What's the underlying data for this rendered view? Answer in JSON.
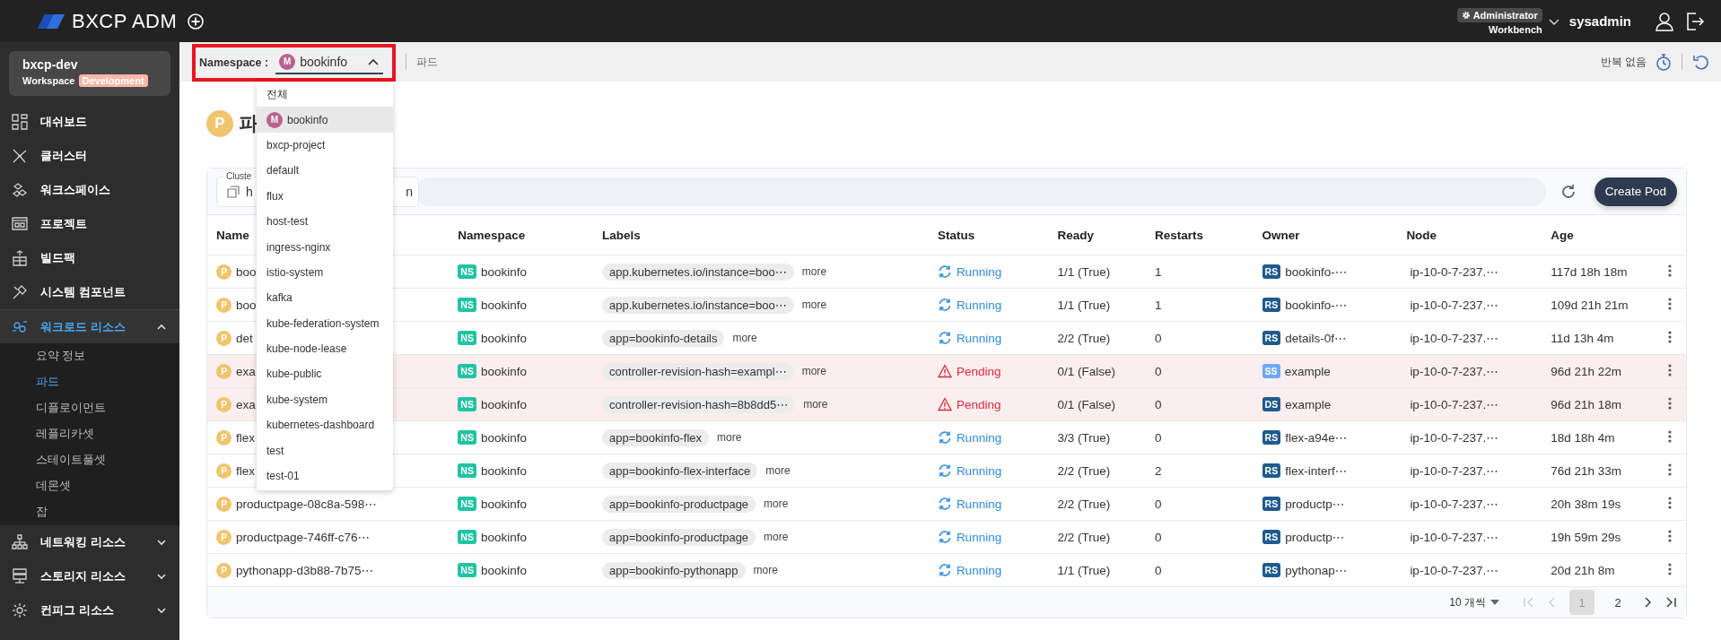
{
  "header": {
    "logo": "BXCP ADM",
    "role": "Administrator",
    "context": "Workbench",
    "user": "sysadmin"
  },
  "workspace": {
    "name": "bxcp-dev",
    "label": "Workspace",
    "env": "Development"
  },
  "sidebar": {
    "items": [
      {
        "label": "대쉬보드",
        "kind": "link",
        "selected": false
      },
      {
        "label": "클러스터",
        "kind": "link",
        "selected": false
      },
      {
        "label": "워크스페이스",
        "kind": "link",
        "selected": false
      },
      {
        "label": "프로젝트",
        "kind": "link",
        "selected": false
      },
      {
        "label": "빌드팩",
        "kind": "link",
        "selected": false
      },
      {
        "label": "시스템 컴포넌트",
        "kind": "link",
        "selected": false
      },
      {
        "label": "워크로드 리소스",
        "kind": "group",
        "selected": true,
        "expanded": true,
        "children": [
          {
            "label": "요약 정보",
            "selected": false
          },
          {
            "label": "파드",
            "selected": true
          },
          {
            "label": "디플로이먼트",
            "selected": false
          },
          {
            "label": "레플리카셋",
            "selected": false
          },
          {
            "label": "스테이트풀셋",
            "selected": false
          },
          {
            "label": "데몬셋",
            "selected": false
          },
          {
            "label": "잡",
            "selected": false
          }
        ]
      },
      {
        "label": "네트워킹 리소스",
        "kind": "group",
        "selected": false,
        "expanded": false
      },
      {
        "label": "스토리지 리소스",
        "kind": "group",
        "selected": false,
        "expanded": false
      },
      {
        "label": "컨피그 리소스",
        "kind": "group",
        "selected": false,
        "expanded": false
      }
    ]
  },
  "breadcrumb": {
    "namespace_label": "Namespace :",
    "namespace": {
      "avatar": "M",
      "value": "bookinfo",
      "open": true
    },
    "current": "파드",
    "repeat": "반복 없음"
  },
  "namespace_menu": {
    "items": [
      {
        "label": "전체",
        "selected": false
      },
      {
        "label": "bookinfo",
        "avatar": "M",
        "selected": true
      },
      {
        "label": "bxcp-project",
        "selected": false
      },
      {
        "label": "default",
        "selected": false
      },
      {
        "label": "flux",
        "selected": false
      },
      {
        "label": "host-test",
        "selected": false
      },
      {
        "label": "ingress-nginx",
        "selected": false
      },
      {
        "label": "istio-system",
        "selected": false
      },
      {
        "label": "kafka",
        "selected": false
      },
      {
        "label": "kube-federation-system",
        "selected": false
      },
      {
        "label": "kube-node-lease",
        "selected": false
      },
      {
        "label": "kube-public",
        "selected": false
      },
      {
        "label": "kube-system",
        "selected": false
      },
      {
        "label": "kubernetes-dashboard",
        "selected": false
      },
      {
        "label": "test",
        "selected": false
      },
      {
        "label": "test-01",
        "selected": false
      }
    ]
  },
  "page": {
    "badge": "P",
    "title": "파"
  },
  "toolbar": {
    "cluster_label": "Cluste",
    "cluster_value_start": "h",
    "cluster_value_end": "n",
    "create_button": "Create Pod"
  },
  "table": {
    "columns": [
      "Name",
      "Namespace",
      "Labels",
      "Status",
      "Ready",
      "Restarts",
      "Owner",
      "Node",
      "Age"
    ],
    "rows": [
      {
        "badge": "P",
        "name": "boo",
        "ns_badge": "NS",
        "namespace": "bookinfo",
        "label": "app.kubernetes.io/instance=boo⋯",
        "more": "more",
        "status": {
          "kind": "running",
          "text": "Running"
        },
        "ready": "1/1 (True)",
        "restarts": "1",
        "owner": {
          "badge": "RS",
          "color": "#1f5a8c",
          "name": "bookinfo-⋯"
        },
        "node": "ip-10-0-7-237.⋯",
        "age": "117d 18h 18m"
      },
      {
        "badge": "P",
        "name": "boo",
        "ns_badge": "NS",
        "namespace": "bookinfo",
        "label": "app.kubernetes.io/instance=boo⋯",
        "more": "more",
        "status": {
          "kind": "running",
          "text": "Running"
        },
        "ready": "1/1 (True)",
        "restarts": "1",
        "owner": {
          "badge": "RS",
          "color": "#1f5a8c",
          "name": "bookinfo-⋯"
        },
        "node": "ip-10-0-7-237.⋯",
        "age": "109d 21h 21m"
      },
      {
        "badge": "P",
        "name": "det",
        "ns_badge": "NS",
        "namespace": "bookinfo",
        "label": "app=bookinfo-details",
        "more": "more",
        "status": {
          "kind": "running",
          "text": "Running"
        },
        "ready": "2/2 (True)",
        "restarts": "0",
        "owner": {
          "badge": "RS",
          "color": "#1f5a8c",
          "name": "details-0f⋯"
        },
        "node": "ip-10-0-7-237.⋯",
        "age": "11d 13h 4m"
      },
      {
        "badge": "P",
        "name": "exa",
        "ns_badge": "NS",
        "namespace": "bookinfo",
        "label": "controller-revision-hash=exampl⋯",
        "more": "more",
        "status": {
          "kind": "pending",
          "text": "Pending"
        },
        "ready": "0/1 (False)",
        "restarts": "0",
        "owner": {
          "badge": "SS",
          "color": "#6ea8f7",
          "name": "example"
        },
        "node": "ip-10-0-7-237.⋯",
        "age": "96d 21h 22m"
      },
      {
        "badge": "P",
        "name": "exa",
        "ns_badge": "NS",
        "namespace": "bookinfo",
        "label": "controller-revision-hash=8b8dd5⋯",
        "more": "more",
        "status": {
          "kind": "pending",
          "text": "Pending"
        },
        "ready": "0/1 (False)",
        "restarts": "0",
        "owner": {
          "badge": "DS",
          "color": "#1f5a8c",
          "name": "example"
        },
        "node": "ip-10-0-7-237.⋯",
        "age": "96d 21h 18m"
      },
      {
        "badge": "P",
        "name": "flex",
        "ns_badge": "NS",
        "namespace": "bookinfo",
        "label": "app=bookinfo-flex",
        "more": "more",
        "status": {
          "kind": "running",
          "text": "Running"
        },
        "ready": "3/3 (True)",
        "restarts": "0",
        "owner": {
          "badge": "RS",
          "color": "#1f5a8c",
          "name": "flex-a94e⋯"
        },
        "node": "ip-10-0-7-237.⋯",
        "age": "18d 18h 4m"
      },
      {
        "badge": "P",
        "name": "flex",
        "ns_badge": "NS",
        "namespace": "bookinfo",
        "label": "app=bookinfo-flex-interface",
        "more": "more",
        "status": {
          "kind": "running",
          "text": "Running"
        },
        "ready": "2/2 (True)",
        "restarts": "2",
        "owner": {
          "badge": "RS",
          "color": "#1f5a8c",
          "name": "flex-interf⋯"
        },
        "node": "ip-10-0-7-237.⋯",
        "age": "76d 21h 33m"
      },
      {
        "badge": "P",
        "name": "productpage-08c8a-598⋯",
        "ns_badge": "NS",
        "namespace": "bookinfo",
        "label": "app=bookinfo-productpage",
        "more": "more",
        "status": {
          "kind": "running",
          "text": "Running"
        },
        "ready": "2/2 (True)",
        "restarts": "0",
        "owner": {
          "badge": "RS",
          "color": "#1f5a8c",
          "name": "productp⋯"
        },
        "node": "ip-10-0-7-237.⋯",
        "age": "20h 38m 19s"
      },
      {
        "badge": "P",
        "name": "productpage-746ff-c76⋯",
        "ns_badge": "NS",
        "namespace": "bookinfo",
        "label": "app=bookinfo-productpage",
        "more": "more",
        "status": {
          "kind": "running",
          "text": "Running"
        },
        "ready": "2/2 (True)",
        "restarts": "0",
        "owner": {
          "badge": "RS",
          "color": "#1f5a8c",
          "name": "productp⋯"
        },
        "node": "ip-10-0-7-237.⋯",
        "age": "19h 59m 29s"
      },
      {
        "badge": "P",
        "name": "pythonapp-d3b88-7b75⋯",
        "ns_badge": "NS",
        "namespace": "bookinfo",
        "label": "app=bookinfo-pythonapp",
        "more": "more",
        "status": {
          "kind": "running",
          "text": "Running"
        },
        "ready": "1/1 (True)",
        "restarts": "0",
        "owner": {
          "badge": "RS",
          "color": "#1f5a8c",
          "name": "pythonap⋯"
        },
        "node": "ip-10-0-7-237.⋯",
        "age": "20d 21h 8m"
      }
    ]
  },
  "pagination": {
    "page_size": "10 개씩",
    "first_disabled": true,
    "prev_disabled": true,
    "next_disabled": false,
    "last_disabled": false,
    "pages": [
      {
        "label": "1",
        "selected": true
      },
      {
        "label": "2",
        "selected": false
      }
    ]
  }
}
